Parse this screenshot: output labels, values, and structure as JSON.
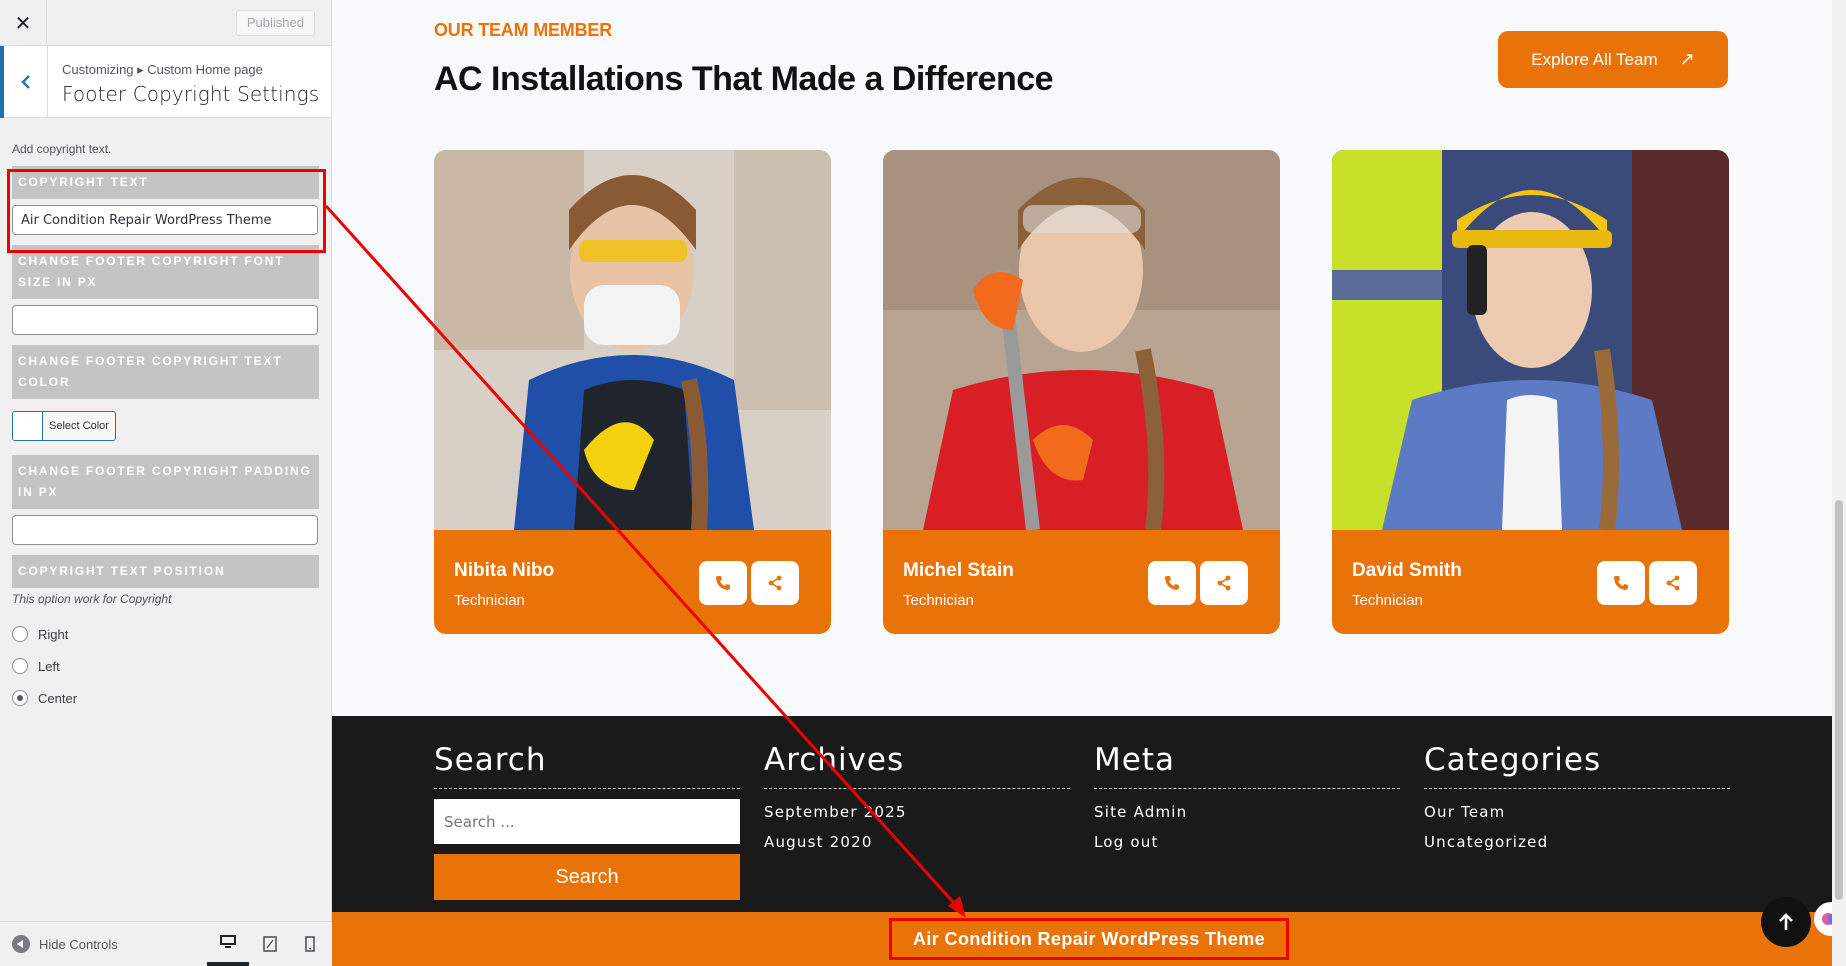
{
  "customizer": {
    "close_icon": "close-icon",
    "published_label": "Published",
    "breadcrumb": "Customizing ▸ Custom Home page",
    "section_title": "Footer Copyright Settings",
    "description": "Add copyright text.",
    "copyright_text_label": "Copyright Text",
    "copyright_text_value": "Air Condition Repair WordPress Theme",
    "font_size_label": "Change Footer Copyright Font Size in px",
    "font_size_value": "",
    "text_color_label": "Change Footer Copyright Text Color",
    "select_color_label": "Select Color",
    "padding_label": "Change Footer Copyright Padding in px",
    "padding_value": "",
    "position_label": "Copyright Text Position",
    "position_note": "This option work for Copyright",
    "position_options": [
      "Right",
      "Left",
      "Center"
    ],
    "position_selected": "Center",
    "hide_controls_label": "Hide Controls",
    "devices": [
      "desktop",
      "tablet",
      "mobile"
    ],
    "active_device": "desktop"
  },
  "team_section": {
    "tag": "OUR TEAM MEMBER",
    "title": "AC Installations That Made a Difference",
    "explore_button": "Explore All Team",
    "members": [
      {
        "name": "Nibita Nibo",
        "role": "Technician"
      },
      {
        "name": "Michel Stain",
        "role": "Technician"
      },
      {
        "name": "David Smith",
        "role": "Technician"
      }
    ]
  },
  "footer": {
    "search": {
      "heading": "Search",
      "placeholder": "Search ...",
      "button": "Search"
    },
    "archives": {
      "heading": "Archives",
      "items": [
        "September 2025",
        "August 2020"
      ]
    },
    "meta": {
      "heading": "Meta",
      "items": [
        "Site Admin",
        "Log out"
      ]
    },
    "categories": {
      "heading": "Categories",
      "items": [
        "Our Team",
        "Uncategorized"
      ]
    },
    "copyright": "Air Condition Repair WordPress Theme"
  },
  "colors": {
    "accent": "#e97309",
    "footer_bg": "#1a1a1a",
    "highlight": "#ee0000",
    "wp_blue": "#2271b1"
  }
}
